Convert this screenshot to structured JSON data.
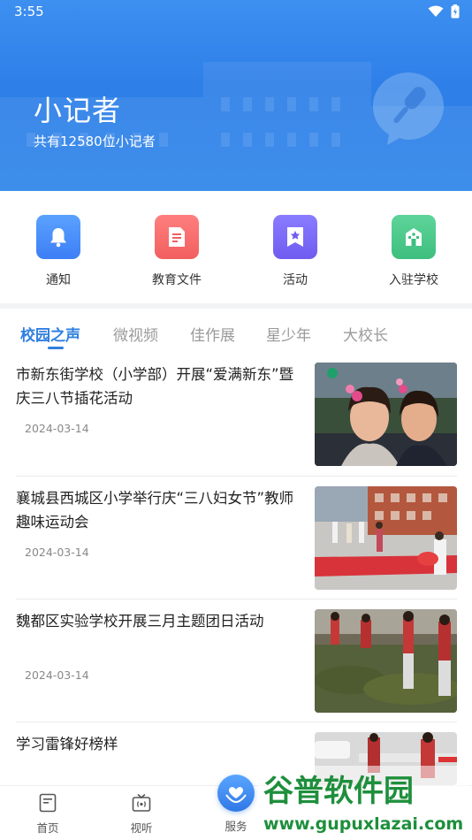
{
  "status_bar": {
    "time": "3:55"
  },
  "header": {
    "title": "小记者",
    "subtitle": "共有12580位小记者",
    "gradient_top": "#3d8ff0",
    "gradient_bottom": "#2f86ea",
    "badge_icon": "microphone-speech-bubble-icon"
  },
  "actions": [
    {
      "label": "通知",
      "icon": "bell-icon",
      "color_top": "#5aa2ff",
      "color_bottom": "#3d7ef5"
    },
    {
      "label": "教育文件",
      "icon": "document-icon",
      "color_top": "#ff7f7f",
      "color_bottom": "#f25f5f"
    },
    {
      "label": "活动",
      "icon": "star-bookmark-icon",
      "color_top": "#8a7cff",
      "color_bottom": "#6f5cf0"
    },
    {
      "label": "入驻学校",
      "icon": "school-building-icon",
      "color_top": "#5fd49a",
      "color_bottom": "#3dbf7e"
    }
  ],
  "tabs": [
    "校园之声",
    "微视频",
    "佳作展",
    "星少年",
    "大校长"
  ],
  "active_tab": "校园之声",
  "accent_color": "#2f7fe0",
  "news": [
    {
      "title": "市新东街学校（小学部）开展“爱满新东”暨庆三八节插花活动",
      "date": "2024-03-14"
    },
    {
      "title": "襄城县西城区小学举行庆“三八妇女节”教师趣味运动会",
      "date": "2024-03-14"
    },
    {
      "title": "魏都区实验学校开展三月主题团日活动",
      "date": "2024-03-14"
    },
    {
      "title": "学习雷锋好榜样",
      "date": ""
    }
  ],
  "bottom_nav": {
    "home": "首页",
    "video": "视听",
    "service": "服务"
  },
  "watermark": {
    "name": "谷普软件园",
    "url": "www.gupuxlazai.com"
  }
}
